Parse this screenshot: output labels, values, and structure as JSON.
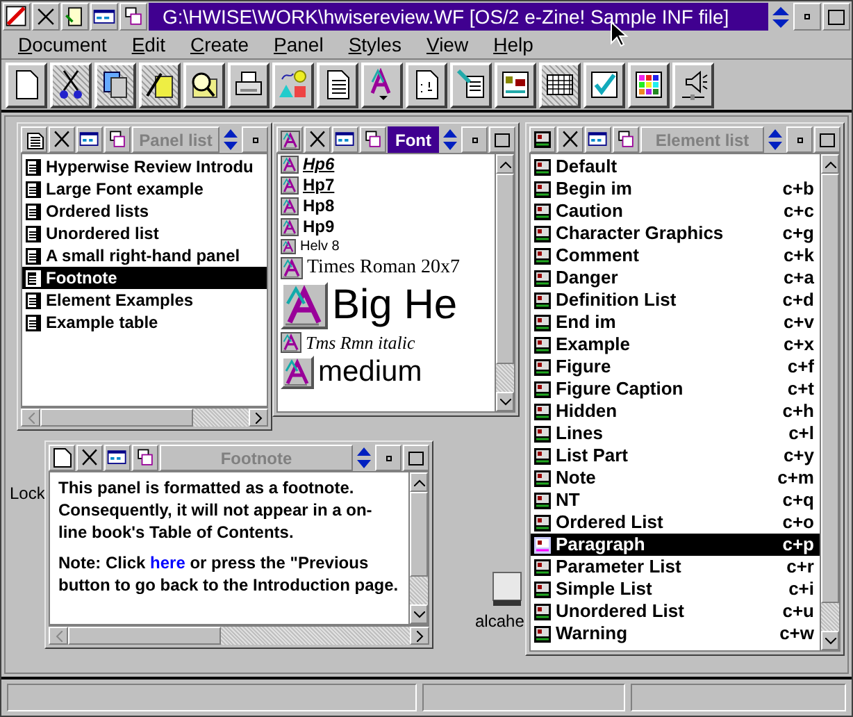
{
  "window": {
    "title": "G:\\HWISE\\WORK\\hwisereview.WF [OS/2 e-Zine! Sample INF file]"
  },
  "menu": [
    {
      "label": "Document"
    },
    {
      "label": "Edit"
    },
    {
      "label": "Create"
    },
    {
      "label": "Panel"
    },
    {
      "label": "Styles"
    },
    {
      "label": "View"
    },
    {
      "label": "Help"
    }
  ],
  "toolbar": [
    {
      "disabled": false
    },
    {
      "disabled": true
    },
    {
      "disabled": true
    },
    {
      "disabled": true
    },
    {
      "disabled": false
    },
    {
      "disabled": false
    },
    {
      "disabled": false
    },
    {
      "disabled": false
    },
    {
      "disabled": false
    },
    {
      "disabled": false
    },
    {
      "disabled": false
    },
    {
      "disabled": false
    },
    {
      "disabled": true
    },
    {
      "disabled": false
    },
    {
      "disabled": false
    },
    {
      "disabled": false
    }
  ],
  "panel_list": {
    "title": "Panel list",
    "active": false,
    "items": [
      {
        "label": "Hyperwise Review Introdu",
        "selected": false
      },
      {
        "label": "Large Font example",
        "selected": false
      },
      {
        "label": "Ordered lists",
        "selected": false
      },
      {
        "label": "Unordered list",
        "selected": false
      },
      {
        "label": "A small right-hand panel",
        "selected": false
      },
      {
        "label": "Footnote",
        "selected": true
      },
      {
        "label": "Element Examples",
        "selected": false
      },
      {
        "label": "Example table",
        "selected": false
      }
    ]
  },
  "font_window": {
    "title": "Font",
    "active": true,
    "items": [
      {
        "label": "Hp6",
        "kind": "hp6"
      },
      {
        "label": "Hp7",
        "kind": "hp7"
      },
      {
        "label": "Hp8",
        "kind": "bold"
      },
      {
        "label": "Hp9",
        "kind": "bold"
      },
      {
        "label": "Helv 8",
        "kind": "helv"
      },
      {
        "label": "Times Roman 20x7",
        "kind": "tms"
      },
      {
        "label": "Big He",
        "kind": "big"
      },
      {
        "label": "Tms Rmn italic",
        "kind": "tmsitalic"
      },
      {
        "label": "medium",
        "kind": "medium"
      }
    ]
  },
  "element_list": {
    "title": "Element list",
    "active": false,
    "items": [
      {
        "label": "Default",
        "selected": false
      },
      {
        "label": "Begin im",
        "shortcut": "c+b",
        "selected": false
      },
      {
        "label": "Caution",
        "shortcut": "c+c",
        "selected": false
      },
      {
        "label": "Character Graphics",
        "shortcut": "c+g",
        "selected": false
      },
      {
        "label": "Comment",
        "shortcut": "c+k",
        "selected": false
      },
      {
        "label": "Danger",
        "shortcut": "c+a",
        "selected": false
      },
      {
        "label": "Definition List",
        "shortcut": "c+d",
        "selected": false
      },
      {
        "label": "End im",
        "shortcut": "c+v",
        "selected": false
      },
      {
        "label": "Example",
        "shortcut": "c+x",
        "selected": false
      },
      {
        "label": "Figure",
        "shortcut": "c+f",
        "selected": false
      },
      {
        "label": "Figure Caption",
        "shortcut": "c+t",
        "selected": false
      },
      {
        "label": "Hidden",
        "shortcut": "c+h",
        "selected": false
      },
      {
        "label": "Lines",
        "shortcut": "c+l",
        "selected": false
      },
      {
        "label": "List Part",
        "shortcut": "c+y",
        "selected": false
      },
      {
        "label": "Note",
        "shortcut": "c+m",
        "selected": false
      },
      {
        "label": "NT",
        "shortcut": "c+q",
        "selected": false
      },
      {
        "label": "Ordered List",
        "shortcut": "c+o",
        "selected": false
      },
      {
        "label": "Paragraph",
        "shortcut": "c+p",
        "selected": true
      },
      {
        "label": "Parameter List",
        "shortcut": "c+r",
        "selected": false
      },
      {
        "label": "Simple List",
        "shortcut": "c+i",
        "selected": false
      },
      {
        "label": "Unordered List",
        "shortcut": "c+u",
        "selected": false
      },
      {
        "label": "Warning",
        "shortcut": "c+w",
        "selected": false
      }
    ]
  },
  "footnote": {
    "title": "Footnote",
    "active": false,
    "paragraph": "This panel is formatted as a footnote. Consequently, it will not appear in a on-line book's Table of Contents.",
    "note": {
      "lead": "Note:",
      "before": " Click ",
      "link": "here",
      "after": " or press the \"Previous button to go back to the Introduction page."
    }
  },
  "desktop": {
    "labels": [
      "Lock",
      "alcahe"
    ]
  }
}
